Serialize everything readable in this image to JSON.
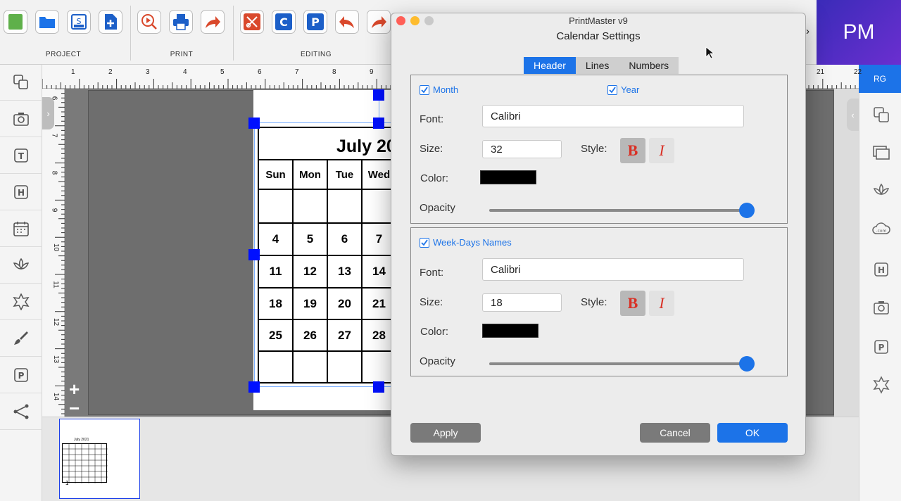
{
  "toolbar": {
    "groups": {
      "project": "PROJECT",
      "print": "PRINT",
      "editing": "EDITING"
    },
    "more_label": "›"
  },
  "brand": {
    "badge": "PM",
    "user_tab": "RG"
  },
  "dialog": {
    "app_title": "PrintMaster v9",
    "title": "Calendar Settings",
    "tabs": [
      "Header",
      "Lines",
      "Numbers"
    ],
    "active_tab": "Header",
    "header_section": {
      "month_label": "Month",
      "month_checked": true,
      "year_label": "Year",
      "year_checked": true,
      "font_label": "Font:",
      "font_value": "Calibri",
      "size_label": "Size:",
      "size_value": "32",
      "style_label": "Style:",
      "bold_glyph": "B",
      "italic_glyph": "I",
      "bold_active": true,
      "italic_active": false,
      "color_label": "Color:",
      "color_value": "#000000",
      "opacity_label": "Opacity",
      "opacity_value": 1.0
    },
    "weekdays_section": {
      "weekdays_label": "Week-Days Names",
      "weekdays_checked": true,
      "font_label": "Font:",
      "font_value": "Calibri",
      "size_label": "Size:",
      "size_value": "18",
      "style_label": "Style:",
      "bold_glyph": "B",
      "italic_glyph": "I",
      "bold_active": true,
      "italic_active": false,
      "color_label": "Color:",
      "color_value": "#000000",
      "opacity_label": "Opacity",
      "opacity_value": 1.0
    },
    "buttons": {
      "apply": "Apply",
      "cancel": "Cancel",
      "ok": "OK"
    }
  },
  "canvas": {
    "zoom_in": "+",
    "zoom_out": "−",
    "ruler_h_numbers": [
      "1",
      "2",
      "3",
      "4",
      "5",
      "6",
      "7",
      "8",
      "9",
      "21",
      "22"
    ],
    "ruler_v_numbers": [
      "6",
      "7",
      "8",
      "9",
      "10",
      "11",
      "12",
      "13",
      "14"
    ],
    "calendar": {
      "title": "July 20",
      "weekdays": [
        "Sun",
        "Mon",
        "Tue",
        "Wed"
      ],
      "rows": [
        [
          "",
          "",
          "",
          ""
        ],
        [
          "4",
          "5",
          "6",
          "7"
        ],
        [
          "11",
          "12",
          "13",
          "14"
        ],
        [
          "18",
          "19",
          "20",
          "21"
        ],
        [
          "25",
          "26",
          "27",
          "28"
        ],
        [
          "",
          "",
          "",
          ""
        ]
      ]
    }
  },
  "thumbnail": {
    "title": "July 2021",
    "page_number": "1"
  },
  "colors": {
    "accent": "#1c73e8",
    "badge": "#4a2dc4",
    "style_red": "#d93025"
  }
}
